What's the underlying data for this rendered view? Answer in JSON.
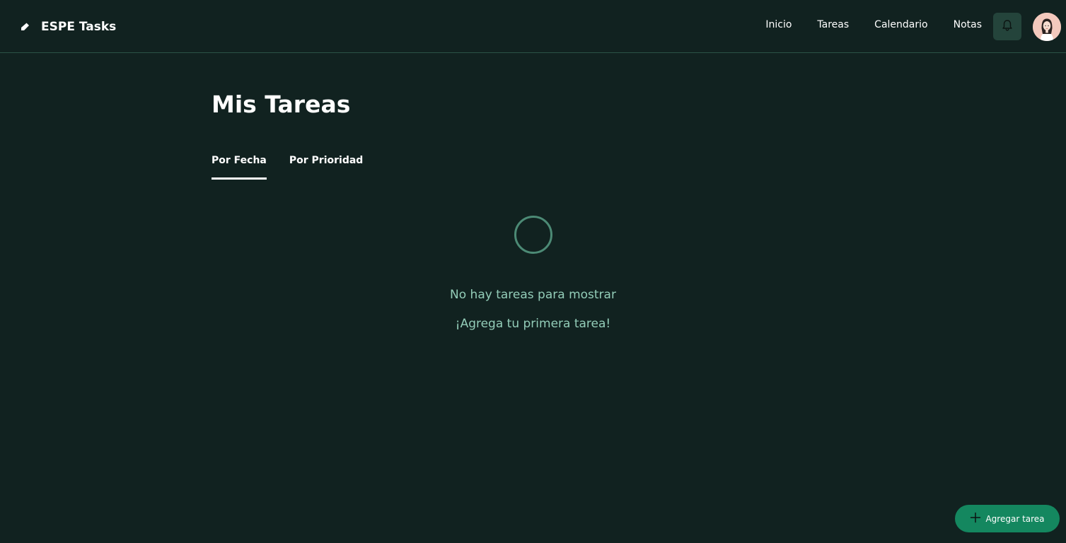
{
  "app": {
    "name": "ESPE Tasks",
    "logo_icon": "diamond-pencil-icon"
  },
  "nav": {
    "items": [
      {
        "label": "Inicio"
      },
      {
        "label": "Tareas"
      },
      {
        "label": "Calendario"
      },
      {
        "label": "Notas"
      }
    ],
    "notifications_icon": "bell-icon",
    "avatar_icon": "user-avatar-icon"
  },
  "main": {
    "title": "Mis Tareas",
    "tabs": [
      {
        "label": "Por Fecha",
        "active": true
      },
      {
        "label": "Por Prioridad",
        "active": false
      }
    ],
    "empty_state": {
      "icon": "circle-icon",
      "title": "No hay tareas para mostrar",
      "subtitle": "¡Agrega tu primera tarea!"
    }
  },
  "fab": {
    "label": "Agregar tarea",
    "icon": "plus-icon"
  },
  "colors": {
    "background": "#112220",
    "accent": "#14875f",
    "muted_text": "#93cdb8",
    "header_border": "#2b5246"
  }
}
